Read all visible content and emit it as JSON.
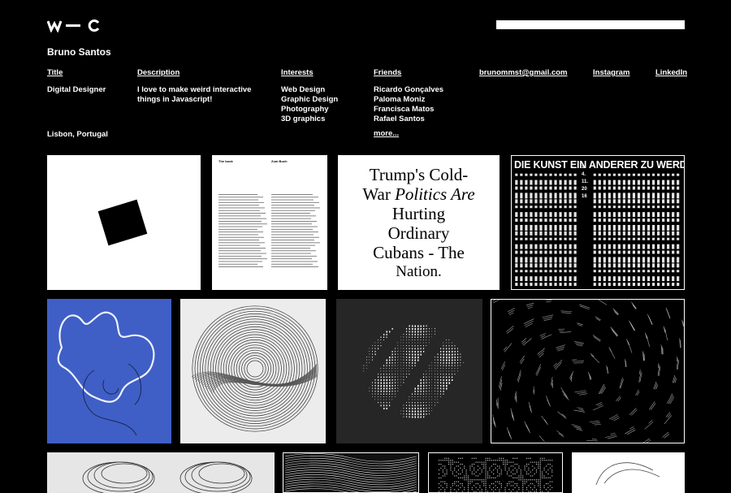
{
  "logo": {
    "text": "w—c"
  },
  "profile": {
    "name": "Bruno Santos",
    "title_label": "Title",
    "title": "Digital Designer",
    "location": "Lisbon, Portugal",
    "description_label": "Description",
    "description_line1": "I love to make weird interactive",
    "description_line2": "things in Javascript!",
    "interests_label": "Interests",
    "interests": [
      "Web Design",
      "Graphic Design",
      "Photography",
      "3D graphics"
    ],
    "friends_label": "Friends",
    "friends": [
      "Ricardo Gonçalves",
      "Paloma Moniz",
      "Francisca Matos",
      "Rafael Santos"
    ],
    "more_label": "more...",
    "email": "brunommst@gmail.com",
    "instagram": "Instagram",
    "linkedin": "LinkedIn"
  },
  "tiles": {
    "poster": {
      "line1a": "Trump's Cold-",
      "line2a": "War ",
      "line2b": "Politics Are",
      "line3": "Hurting",
      "line4": "Ordinary",
      "line5": "Cubans - The",
      "line6": "Nation."
    },
    "book": {
      "left_head": "The book",
      "right_head": "Zum Buch"
    },
    "kunst": {
      "text": "DIE KUNST EIN ANDERER ZU WERDEN",
      "date": "14.11.2016"
    }
  }
}
